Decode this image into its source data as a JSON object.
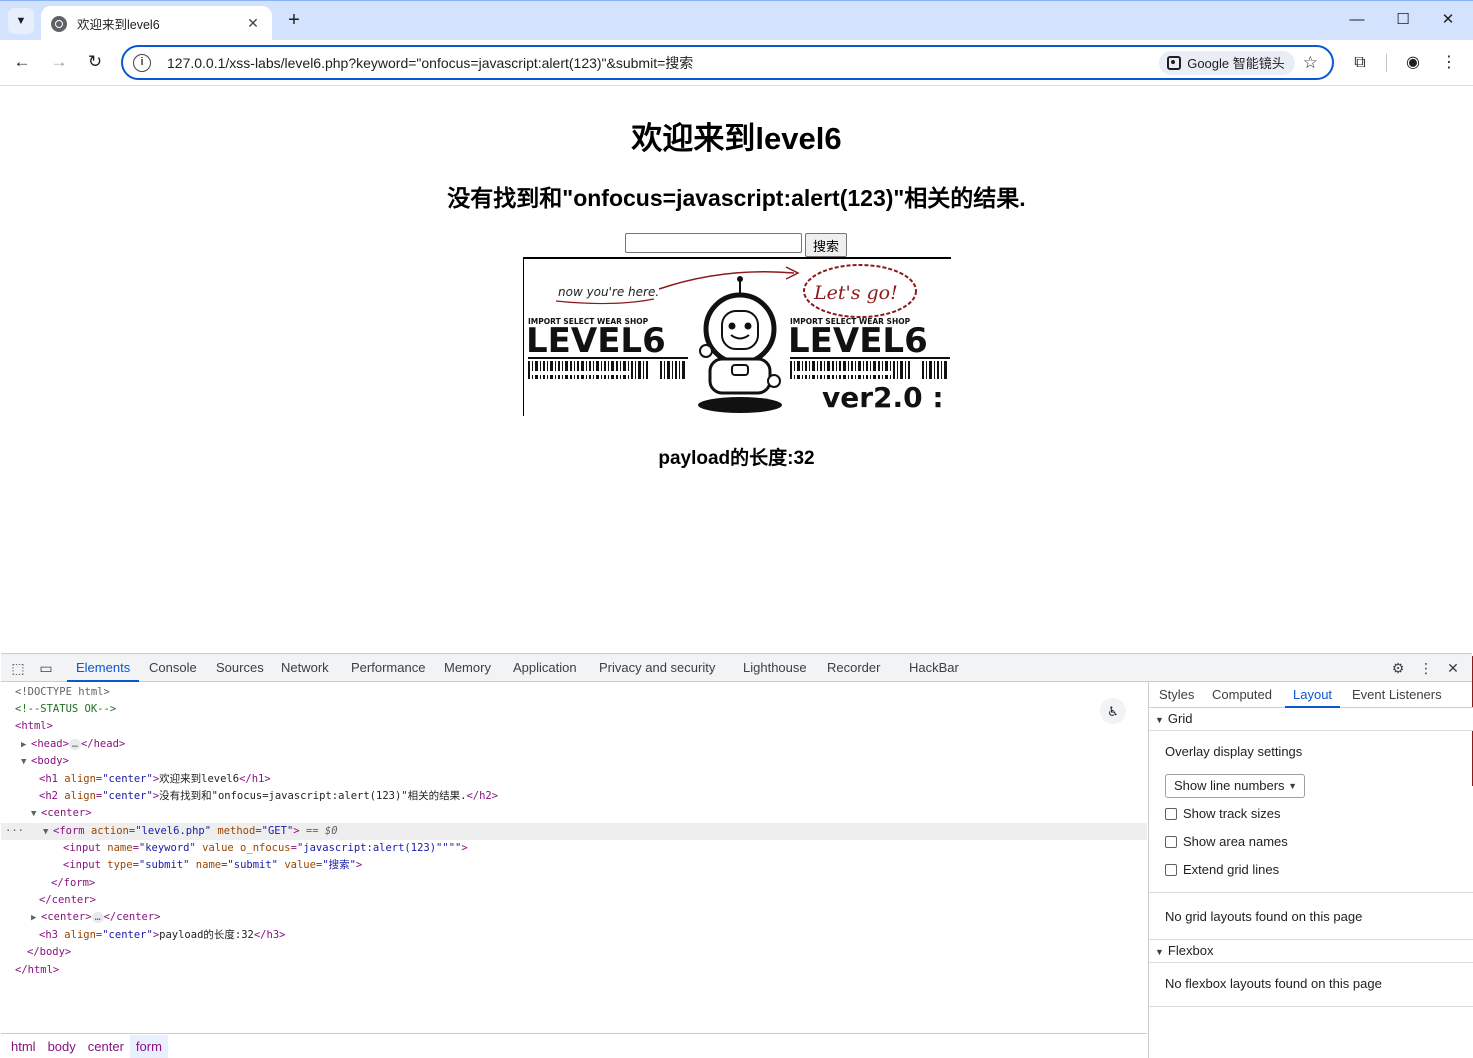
{
  "browser": {
    "tab_title": "欢迎来到level6",
    "url": "127.0.0.1/xss-labs/level6.php?keyword=\"onfocus=javascript:alert(123)\"&submit=搜索",
    "lens_label": "Google 智能镜头"
  },
  "page": {
    "h1": "欢迎来到level6",
    "h2": "没有找到和\"onfocus=javascript:alert(123)\"相关的结果.",
    "search_value": "",
    "submit_label": "搜索",
    "h3": "payload的长度:32",
    "image": {
      "note_text": "now you're here.",
      "bubble_text": "Let's go!",
      "shop_text": "IMPORT SELECT WEAR SHOP",
      "level_text": "LEVEL6",
      "version_text": "ver2.0 :"
    }
  },
  "devtools": {
    "tabs": [
      "Elements",
      "Console",
      "Sources",
      "Network",
      "Performance",
      "Memory",
      "Application",
      "Privacy and security",
      "Lighthouse",
      "Recorder",
      "HackBar"
    ],
    "active_tab": "Elements",
    "source": {
      "doctype": "<!DOCTYPE html>",
      "comment": "<!--STATUS OK-->",
      "h1_text": "欢迎来到level6",
      "h2_text": "没有找到和\"onfocus=javascript:alert(123)\"相关的结果.",
      "h3_text": "payload的长度:32",
      "form_action": "\"level6.php\"",
      "form_method": "\"GET\"",
      "input1_name": "\"keyword\"",
      "input1_onfocus": "\"javascript:alert(123)\"",
      "input1_tail": "\"\"\"",
      "input2_type": "\"submit\"",
      "input2_name": "\"submit\"",
      "input2_value": "\"搜索\"",
      "align_center": "\"center\"",
      "selected_marker": "== $0"
    },
    "breadcrumbs": [
      "html",
      "body",
      "center",
      "form"
    ],
    "side_tabs": [
      "Styles",
      "Computed",
      "Layout",
      "Event Listeners"
    ],
    "side_active": "Layout",
    "grid": {
      "title": "Grid",
      "overlay_label": "Overlay display settings",
      "select_value": "Show line numbers",
      "checks": [
        "Show track sizes",
        "Show area names",
        "Extend grid lines"
      ],
      "empty_msg": "No grid layouts found on this page"
    },
    "flexbox": {
      "title": "Flexbox",
      "empty_msg": "No flexbox layouts found on this page"
    }
  }
}
